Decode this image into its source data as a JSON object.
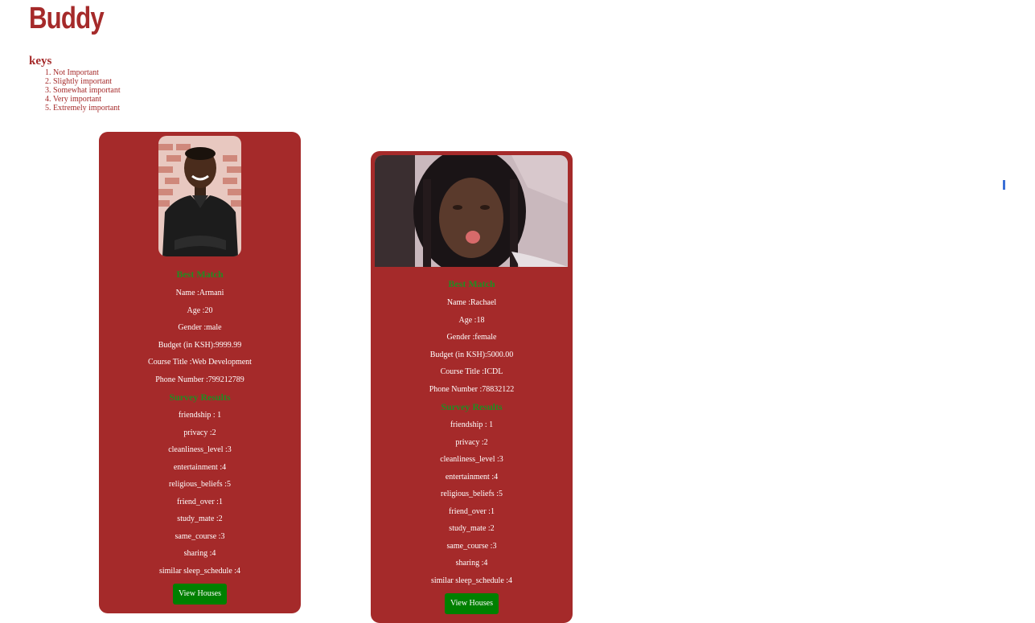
{
  "app": {
    "title": "Buddy"
  },
  "keys": {
    "title": "keys",
    "items": [
      "1. Not Important",
      "2. Slightly important",
      "3. Somewhat important",
      "4. Very important",
      "5. Extremely important"
    ]
  },
  "colors": {
    "brand": "#a52a2a",
    "card": "#a52a2a",
    "section_title": "#228b22",
    "button": "#008000",
    "scroll_indicator": "#3b6fd6"
  },
  "cards": [
    {
      "photo_alt": "photo",
      "best_match_title": "Best Match",
      "name": "Name :Armani",
      "age": "Age :20",
      "gender": "Gender :male",
      "budget": "Budget (in KSH):9999.99",
      "course": "Course Title :Web Development",
      "phone": "Phone Number :799212789",
      "survey_title": "Survey Results",
      "survey": [
        "friendship : 1",
        "privacy :2",
        "cleanliness_level :3",
        "entertainment :4",
        "religious_beliefs :5",
        "friend_over :1",
        "study_mate :2",
        "same_course :3",
        "sharing :4",
        "similar sleep_schedule :4"
      ],
      "button_label": "View Houses"
    },
    {
      "photo_alt": "photo",
      "best_match_title": "Best Match",
      "name": "Name :Rachael",
      "age": "Age :18",
      "gender": "Gender :female",
      "budget": "Budget (in KSH):5000.00",
      "course": "Course Title :ICDL",
      "phone": "Phone Number :78832122",
      "survey_title": "Survey Results",
      "survey": [
        "friendship : 1",
        "privacy :2",
        "cleanliness_level :3",
        "entertainment :4",
        "religious_beliefs :5",
        "friend_over :1",
        "study_mate :2",
        "same_course :3",
        "sharing :4",
        "similar sleep_schedule :4"
      ],
      "button_label": "View Houses"
    }
  ]
}
